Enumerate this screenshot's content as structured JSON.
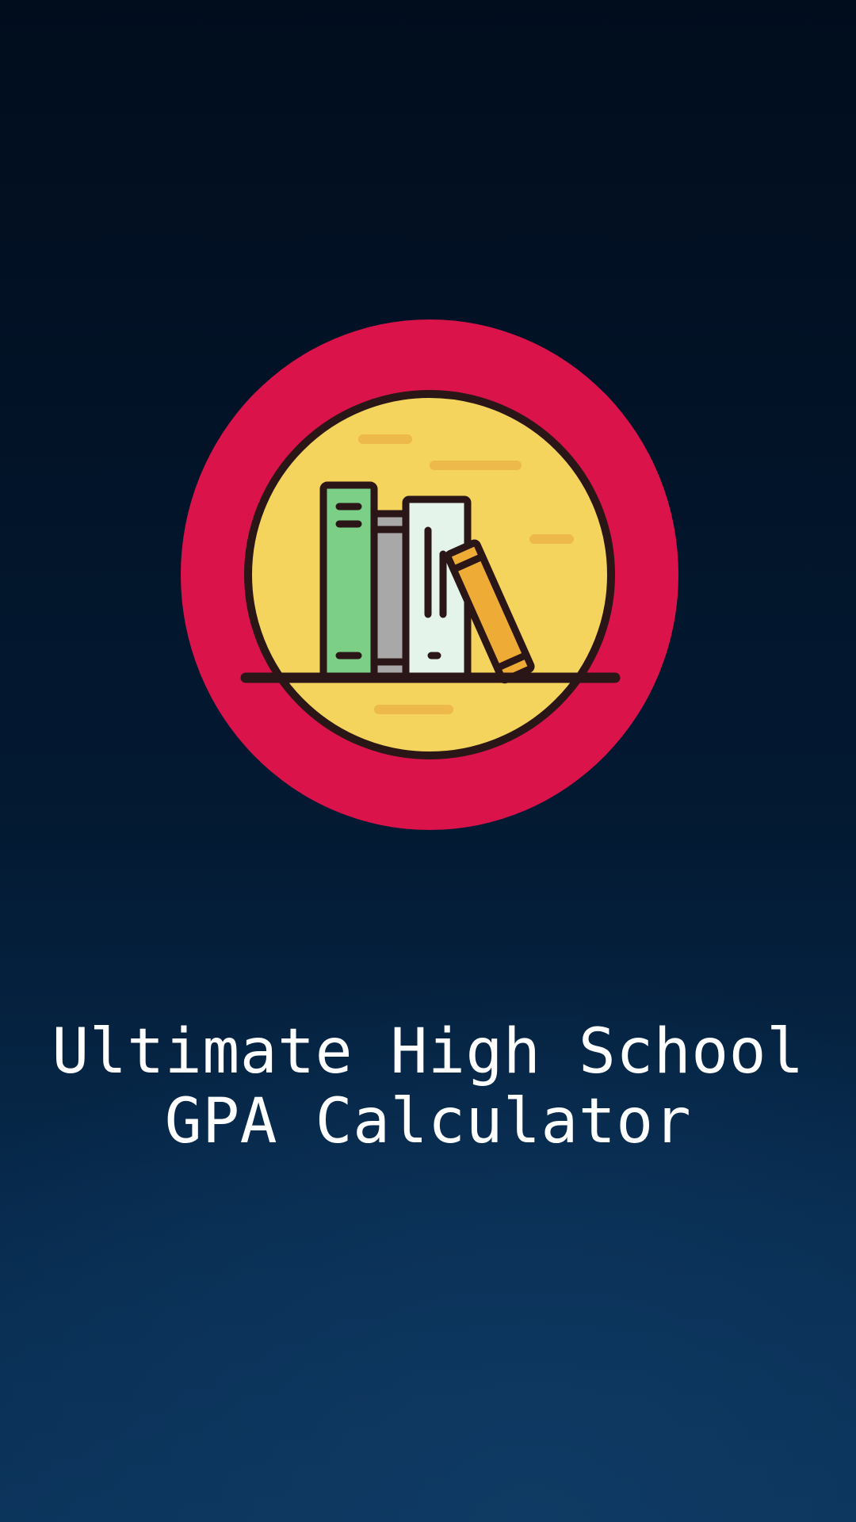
{
  "app": {
    "logo_icon": "bookshelf-icon",
    "title_line1": "Ultimate High School",
    "title_line2": "GPA Calculator"
  },
  "colors": {
    "background_top": "#010d1d",
    "background_bottom": "#0b335a",
    "logo_ring": "#db134b",
    "logo_face": "#f5d45e",
    "book_green": "#7bcf86",
    "book_grey": "#a8a8a8",
    "book_white": "#e4f4ea",
    "book_orange": "#eeab36",
    "outline": "#2a1517",
    "title_text": "#ffffff"
  }
}
